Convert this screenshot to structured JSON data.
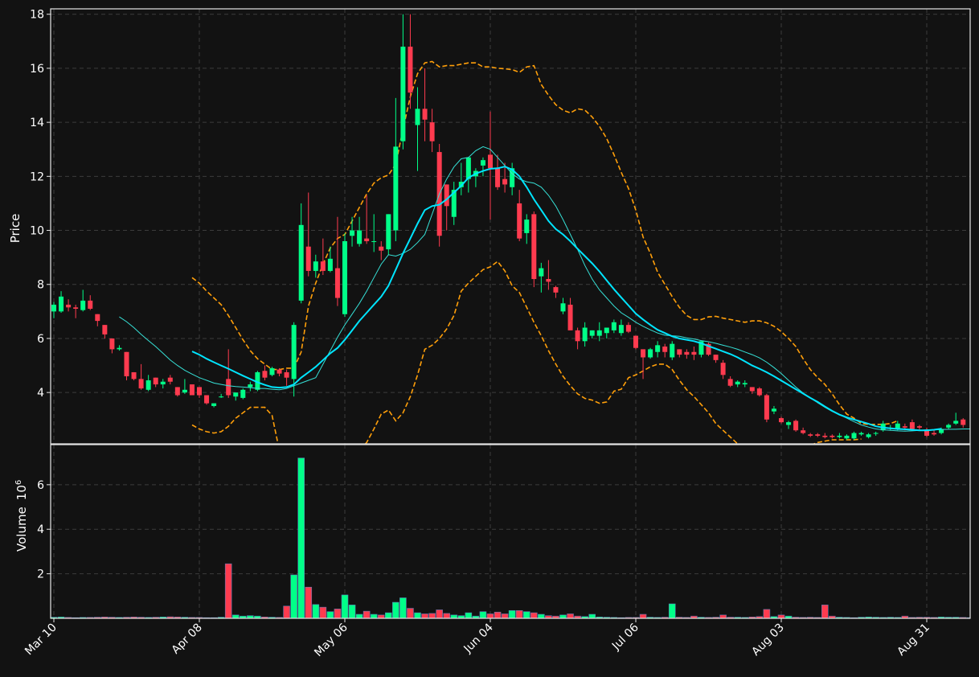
{
  "chart_data": {
    "type": "candlestick",
    "price_axis": {
      "label": "Price",
      "ticks": [
        "4",
        "6",
        "8",
        "10",
        "12",
        "14",
        "16",
        "18"
      ],
      "range": [
        2.1,
        18.2
      ]
    },
    "volume_axis": {
      "label": "Volume",
      "exponent_label": "10",
      "exponent": "6",
      "ticks": [
        "2",
        "4",
        "6"
      ],
      "range": [
        0,
        7.8
      ]
    },
    "x_ticks": [
      {
        "label": "Mar 10",
        "index": 0
      },
      {
        "label": "Apr 08",
        "index": 20
      },
      {
        "label": "May 06",
        "index": 40
      },
      {
        "label": "Jun 04",
        "index": 60
      },
      {
        "label": "Jul 06",
        "index": 80
      },
      {
        "label": "Aug 03",
        "index": 100
      },
      {
        "label": "Aug 31",
        "index": 120
      }
    ],
    "grid": true,
    "colors": {
      "up": "#00ff88",
      "down": "#ff3b4f",
      "ma_thin": "#36e0d6",
      "ma_thick": "#00e5ff",
      "band": "#ff9f0a",
      "background": "#121212"
    },
    "ohlc": [
      [
        7.0,
        7.35,
        6.75,
        7.25
      ],
      [
        7.0,
        7.75,
        6.95,
        7.55
      ],
      [
        7.25,
        7.45,
        7.0,
        7.15
      ],
      [
        7.15,
        7.25,
        6.75,
        7.1
      ],
      [
        7.05,
        7.8,
        7.0,
        7.4
      ],
      [
        7.4,
        7.6,
        7.05,
        7.1
      ],
      [
        6.9,
        6.9,
        6.45,
        6.65
      ],
      [
        6.5,
        6.5,
        6.0,
        6.15
      ],
      [
        6.0,
        6.0,
        5.45,
        5.6
      ],
      [
        5.6,
        5.75,
        5.55,
        5.65
      ],
      [
        5.5,
        5.5,
        4.45,
        4.6
      ],
      [
        4.75,
        4.75,
        4.45,
        4.5
      ],
      [
        4.5,
        5.05,
        4.1,
        4.15
      ],
      [
        4.1,
        4.65,
        4.05,
        4.45
      ],
      [
        4.55,
        4.55,
        4.2,
        4.3
      ],
      [
        4.3,
        4.5,
        4.15,
        4.4
      ],
      [
        4.55,
        4.65,
        4.3,
        4.4
      ],
      [
        4.2,
        4.2,
        3.85,
        3.9
      ],
      [
        4.0,
        4.5,
        3.95,
        4.1
      ],
      [
        4.3,
        4.3,
        3.9,
        3.9
      ],
      [
        4.2,
        4.2,
        3.8,
        3.9
      ],
      [
        3.9,
        3.9,
        3.55,
        3.6
      ],
      [
        3.5,
        3.6,
        3.45,
        3.6
      ],
      [
        3.85,
        3.95,
        3.8,
        3.85
      ],
      [
        4.5,
        5.6,
        3.8,
        3.9
      ],
      [
        3.85,
        3.95,
        3.7,
        4.0
      ],
      [
        3.8,
        4.15,
        3.75,
        4.1
      ],
      [
        4.2,
        4.4,
        4.05,
        4.3
      ],
      [
        4.1,
        4.8,
        4.05,
        4.75
      ],
      [
        4.8,
        5.0,
        4.45,
        4.55
      ],
      [
        4.65,
        4.95,
        4.6,
        4.9
      ],
      [
        4.85,
        4.9,
        4.6,
        4.7
      ],
      [
        4.75,
        4.85,
        4.25,
        4.55
      ],
      [
        4.5,
        6.6,
        3.85,
        6.5
      ],
      [
        7.4,
        11.0,
        7.3,
        10.2
      ],
      [
        9.4,
        11.4,
        8.3,
        8.5
      ],
      [
        8.5,
        9.1,
        8.25,
        8.85
      ],
      [
        8.85,
        9.7,
        8.35,
        8.5
      ],
      [
        8.5,
        9.4,
        8.45,
        8.95
      ],
      [
        8.6,
        10.5,
        7.2,
        7.5
      ],
      [
        6.9,
        9.9,
        6.8,
        9.6
      ],
      [
        9.8,
        10.5,
        9.4,
        10.0
      ],
      [
        9.5,
        10.5,
        9.4,
        10.0
      ],
      [
        9.7,
        11.3,
        9.5,
        9.6
      ],
      [
        9.6,
        10.6,
        9.2,
        9.6
      ],
      [
        9.4,
        9.6,
        8.9,
        9.25
      ],
      [
        9.3,
        10.6,
        9.1,
        10.6
      ],
      [
        10.0,
        14.9,
        9.6,
        13.1
      ],
      [
        13.3,
        18.0,
        13.0,
        16.8
      ],
      [
        16.8,
        18.0,
        14.5,
        15.1
      ],
      [
        13.9,
        15.3,
        12.2,
        14.5
      ],
      [
        14.5,
        16.0,
        13.3,
        14.1
      ],
      [
        14.0,
        14.5,
        12.9,
        13.3
      ],
      [
        12.9,
        13.2,
        9.4,
        9.8
      ],
      [
        11.7,
        11.7,
        10.0,
        10.9
      ],
      [
        10.5,
        11.8,
        10.2,
        11.5
      ],
      [
        11.6,
        12.5,
        11.3,
        11.8
      ],
      [
        11.9,
        12.7,
        11.4,
        12.7
      ],
      [
        12.0,
        12.3,
        11.6,
        12.2
      ],
      [
        12.4,
        12.7,
        12.0,
        12.6
      ],
      [
        12.8,
        14.4,
        10.4,
        12.3
      ],
      [
        12.3,
        12.8,
        11.5,
        11.6
      ],
      [
        11.9,
        12.5,
        11.4,
        11.7
      ],
      [
        11.6,
        12.5,
        11.3,
        12.3
      ],
      [
        11.0,
        11.5,
        9.6,
        9.7
      ],
      [
        9.9,
        10.6,
        9.5,
        10.4
      ],
      [
        10.6,
        10.7,
        7.9,
        8.2
      ],
      [
        8.3,
        8.8,
        7.7,
        8.6
      ],
      [
        8.2,
        8.9,
        7.8,
        8.1
      ],
      [
        7.9,
        7.95,
        7.5,
        7.7
      ],
      [
        7.0,
        7.5,
        6.9,
        7.3
      ],
      [
        7.25,
        7.5,
        6.7,
        6.3
      ],
      [
        6.3,
        6.4,
        5.6,
        5.9
      ],
      [
        5.9,
        6.6,
        5.7,
        6.4
      ],
      [
        6.1,
        6.3,
        6.0,
        6.3
      ],
      [
        6.1,
        6.6,
        5.9,
        6.3
      ],
      [
        6.2,
        6.4,
        6.0,
        6.4
      ],
      [
        6.3,
        6.7,
        6.2,
        6.6
      ],
      [
        6.2,
        6.7,
        6.1,
        6.5
      ],
      [
        6.5,
        6.6,
        6.2,
        6.25
      ],
      [
        6.1,
        6.1,
        5.6,
        5.65
      ],
      [
        5.6,
        5.6,
        4.5,
        5.3
      ],
      [
        5.3,
        5.65,
        5.25,
        5.6
      ],
      [
        5.5,
        5.9,
        5.3,
        5.75
      ],
      [
        5.7,
        5.8,
        5.3,
        5.5
      ],
      [
        5.3,
        5.9,
        5.2,
        5.8
      ],
      [
        5.6,
        5.6,
        5.3,
        5.4
      ],
      [
        5.5,
        5.6,
        5.25,
        5.4
      ],
      [
        5.5,
        5.7,
        5.2,
        5.4
      ],
      [
        5.4,
        5.9,
        5.3,
        5.9
      ],
      [
        5.8,
        5.85,
        5.35,
        5.4
      ],
      [
        5.4,
        5.4,
        5.1,
        5.2
      ],
      [
        5.1,
        5.2,
        4.5,
        4.65
      ],
      [
        4.5,
        4.6,
        4.2,
        4.25
      ],
      [
        4.3,
        4.45,
        4.2,
        4.4
      ],
      [
        4.3,
        4.45,
        4.2,
        4.35
      ],
      [
        4.2,
        4.2,
        3.95,
        4.05
      ],
      [
        4.15,
        4.2,
        3.85,
        3.9
      ],
      [
        3.9,
        3.95,
        2.9,
        3.0
      ],
      [
        3.3,
        3.5,
        3.2,
        3.4
      ],
      [
        3.05,
        3.1,
        2.85,
        2.9
      ],
      [
        2.8,
        2.95,
        2.65,
        2.9
      ],
      [
        2.95,
        3.0,
        2.55,
        2.6
      ],
      [
        2.6,
        2.7,
        2.45,
        2.5
      ],
      [
        2.45,
        2.5,
        2.35,
        2.4
      ],
      [
        2.45,
        2.5,
        2.35,
        2.4
      ],
      [
        2.4,
        2.5,
        2.3,
        2.35
      ],
      [
        2.4,
        2.45,
        2.3,
        2.35
      ],
      [
        2.35,
        2.5,
        2.3,
        2.4
      ],
      [
        2.3,
        2.45,
        2.25,
        2.4
      ],
      [
        2.3,
        2.55,
        2.25,
        2.5
      ],
      [
        2.45,
        2.55,
        2.4,
        2.5
      ],
      [
        2.35,
        2.5,
        2.3,
        2.45
      ],
      [
        2.5,
        2.55,
        2.4,
        2.5
      ],
      [
        2.6,
        2.95,
        2.55,
        2.85
      ],
      [
        2.7,
        2.8,
        2.6,
        2.7
      ],
      [
        2.65,
        2.95,
        2.6,
        2.85
      ],
      [
        2.75,
        2.85,
        2.6,
        2.7
      ],
      [
        2.9,
        3.0,
        2.6,
        2.65
      ],
      [
        2.75,
        2.8,
        2.6,
        2.7
      ],
      [
        2.6,
        2.7,
        2.35,
        2.4
      ],
      [
        2.5,
        2.6,
        2.4,
        2.45
      ],
      [
        2.5,
        2.7,
        2.45,
        2.65
      ],
      [
        2.7,
        2.85,
        2.65,
        2.8
      ],
      [
        2.85,
        3.25,
        2.8,
        2.95
      ],
      [
        3.0,
        3.05,
        2.7,
        2.8
      ]
    ],
    "volume": [
      0.05,
      0.06,
      0.04,
      0.03,
      0.04,
      0.04,
      0.05,
      0.06,
      0.05,
      0.04,
      0.05,
      0.06,
      0.05,
      0.04,
      0.05,
      0.06,
      0.07,
      0.06,
      0.05,
      0.04,
      0.04,
      0.03,
      0.03,
      0.05,
      2.45,
      0.15,
      0.1,
      0.12,
      0.1,
      0.06,
      0.05,
      0.04,
      0.55,
      1.95,
      7.2,
      1.4,
      0.62,
      0.5,
      0.3,
      0.42,
      1.05,
      0.6,
      0.18,
      0.32,
      0.18,
      0.15,
      0.25,
      0.72,
      0.92,
      0.45,
      0.25,
      0.2,
      0.22,
      0.38,
      0.22,
      0.15,
      0.12,
      0.25,
      0.1,
      0.3,
      0.2,
      0.28,
      0.2,
      0.35,
      0.35,
      0.3,
      0.25,
      0.18,
      0.12,
      0.1,
      0.15,
      0.2,
      0.1,
      0.08,
      0.18,
      0.06,
      0.05,
      0.04,
      0.03,
      0.04,
      0.04,
      0.18,
      0.05,
      0.04,
      0.05,
      0.65,
      0.05,
      0.04,
      0.1,
      0.05,
      0.04,
      0.05,
      0.15,
      0.05,
      0.05,
      0.04,
      0.06,
      0.08,
      0.4,
      0.08,
      0.15,
      0.1,
      0.05,
      0.04,
      0.05,
      0.04,
      0.6,
      0.1,
      0.05,
      0.04,
      0.03,
      0.05,
      0.06,
      0.05,
      0.04,
      0.05,
      0.04,
      0.1,
      0.04,
      0.05,
      0.05,
      0.04,
      0.06,
      0.05,
      0.05,
      0.04,
      0.03,
      0.05,
      0.04,
      0.12,
      0.05
    ],
    "overlays": {
      "ma_thin": {
        "start_index": 9,
        "values": [
          6.8,
          6.62,
          6.4,
          6.15,
          5.92,
          5.7,
          5.45,
          5.2,
          5.0,
          4.82,
          4.68,
          4.55,
          4.45,
          4.35,
          4.3,
          4.25,
          4.22,
          4.2,
          4.18,
          4.15,
          4.15,
          4.12,
          4.1,
          4.15,
          4.25,
          4.35,
          4.45,
          4.55,
          5.05,
          5.55,
          6.05,
          6.5,
          6.9,
          7.3,
          7.75,
          8.25,
          8.75,
          9.1,
          9.05,
          9.15,
          9.3,
          9.55,
          9.85,
          10.6,
          11.35,
          11.9,
          12.35,
          12.65,
          12.7,
          12.95,
          13.1,
          13.0,
          12.7,
          12.4,
          12.1,
          11.9,
          11.8,
          11.75,
          11.6,
          11.3,
          10.9,
          10.4,
          9.85,
          9.3,
          8.7,
          8.2,
          7.8,
          7.5,
          7.2,
          6.95,
          6.78,
          6.6,
          6.45,
          6.32,
          6.2,
          6.12,
          6.1,
          6.08,
          6.02,
          5.98,
          5.92,
          5.88,
          5.82,
          5.75,
          5.68,
          5.6,
          5.5,
          5.4,
          5.28,
          5.12,
          4.92,
          4.7,
          4.45,
          4.2,
          3.98,
          3.8,
          3.62,
          3.45,
          3.3,
          3.18,
          3.05,
          2.92,
          2.8,
          2.72,
          2.65,
          2.62,
          2.6,
          2.58,
          2.57,
          2.58,
          2.6,
          2.62,
          2.62,
          2.63,
          2.64,
          2.64,
          2.65,
          2.65
        ]
      },
      "ma_thick": {
        "start_index": 19,
        "values": [
          5.52,
          5.4,
          5.25,
          5.12,
          5.0,
          4.88,
          4.75,
          4.62,
          4.5,
          4.38,
          4.28,
          4.2,
          4.18,
          4.2,
          4.3,
          4.55,
          4.75,
          4.95,
          5.2,
          5.45,
          5.65,
          5.95,
          6.3,
          6.65,
          6.95,
          7.25,
          7.55,
          7.95,
          8.55,
          9.15,
          9.7,
          10.25,
          10.75,
          10.9,
          10.95,
          11.15,
          11.4,
          11.65,
          11.95,
          12.1,
          12.2,
          12.28,
          12.3,
          12.36,
          12.25,
          12.0,
          11.6,
          11.15,
          10.75,
          10.35,
          10.05,
          9.85,
          9.6,
          9.32,
          9.05,
          8.78,
          8.48,
          8.15,
          7.82,
          7.52,
          7.22,
          6.92,
          6.7,
          6.5,
          6.32,
          6.2,
          6.08,
          6.0,
          5.95,
          5.9,
          5.82,
          5.72,
          5.62,
          5.52,
          5.42,
          5.3,
          5.15,
          5.0,
          4.88,
          4.75,
          4.6,
          4.44,
          4.28,
          4.12,
          3.96,
          3.8,
          3.65,
          3.48,
          3.32,
          3.18,
          3.08,
          3.0,
          2.92,
          2.84,
          2.75,
          2.7,
          2.67,
          2.65,
          2.64,
          2.62,
          2.6,
          2.6,
          2.62,
          2.66
        ]
      },
      "band_upper": {
        "start_index": 19,
        "values": [
          8.25,
          8.05,
          7.75,
          7.5,
          7.25,
          6.85,
          6.4,
          5.95,
          5.55,
          5.25,
          5.05,
          4.85,
          4.85,
          4.9,
          4.9,
          5.5,
          7.2,
          8.05,
          8.75,
          9.35,
          9.7,
          9.85,
          10.35,
          10.85,
          11.35,
          11.75,
          11.95,
          12.05,
          12.45,
          13.75,
          14.95,
          15.8,
          16.2,
          16.25,
          16.05,
          16.1,
          16.1,
          16.15,
          16.2,
          16.2,
          16.05,
          16.05,
          16.0,
          15.98,
          15.95,
          15.85,
          16.05,
          16.1,
          15.4,
          15.0,
          14.65,
          14.45,
          14.35,
          14.5,
          14.45,
          14.2,
          13.85,
          13.4,
          12.8,
          12.15,
          11.55,
          10.75,
          9.75,
          9.15,
          8.45,
          8.0,
          7.55,
          7.15,
          6.85,
          6.7,
          6.7,
          6.8,
          6.82,
          6.75,
          6.7,
          6.65,
          6.6,
          6.65,
          6.65,
          6.58,
          6.45,
          6.25,
          6.0,
          5.7,
          5.25,
          4.85,
          4.55,
          4.3,
          3.95,
          3.55,
          3.2,
          3.05,
          2.85,
          2.82,
          2.82,
          2.82,
          2.85,
          2.95
        ]
      },
      "band_lower": {
        "start_index": 19,
        "values": [
          2.8,
          2.65,
          2.55,
          2.5,
          2.55,
          2.75,
          3.05,
          3.25,
          3.45,
          3.45,
          3.45,
          3.15,
          1.85,
          1.0,
          0.0,
          -0.5,
          -1.0,
          -1.0,
          -0.5,
          -0.2,
          0.2,
          0.8,
          1.3,
          1.85,
          2.15,
          2.65,
          3.2,
          3.35,
          2.95,
          3.25,
          3.85,
          4.65,
          5.6,
          5.75,
          6.0,
          6.35,
          6.85,
          7.75,
          8.05,
          8.3,
          8.55,
          8.65,
          8.85,
          8.5,
          7.95,
          7.7,
          7.15,
          6.6,
          6.1,
          5.55,
          5.05,
          4.6,
          4.25,
          3.95,
          3.78,
          3.72,
          3.6,
          3.65,
          4.05,
          4.12,
          4.55,
          4.65,
          4.8,
          4.95,
          5.05,
          5.05,
          4.85,
          4.45,
          4.1,
          3.85,
          3.55,
          3.25,
          2.85,
          2.6,
          2.35,
          2.1,
          1.9,
          1.75,
          1.65,
          1.55,
          1.5,
          1.5,
          1.55,
          1.7,
          1.9,
          2.05,
          2.15,
          2.2,
          2.25,
          2.25,
          2.25,
          2.25,
          2.28
        ]
      }
    }
  }
}
